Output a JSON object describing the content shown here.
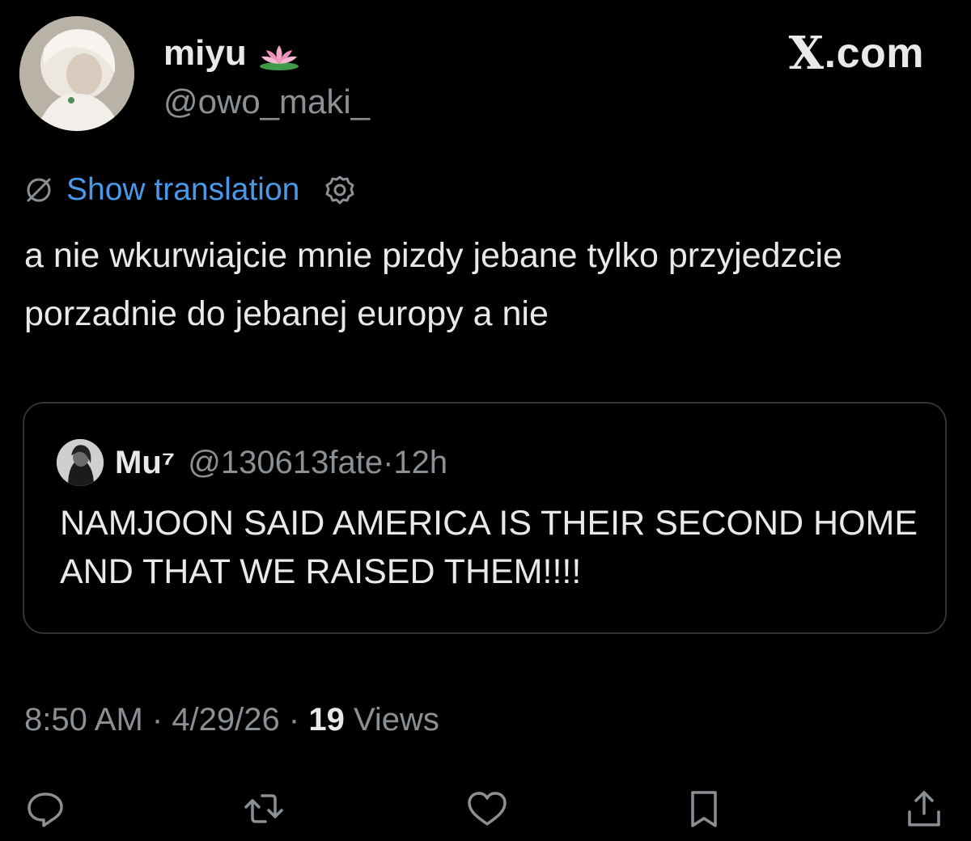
{
  "author": {
    "display_name": "miyu",
    "handle": "@owo_maki_",
    "badge_icon": "lotus-icon"
  },
  "brand": {
    "label": ".com",
    "logo": "X"
  },
  "translation": {
    "label": "Show translation"
  },
  "tweet": {
    "text": "a nie wkurwiajcie mnie pizdy jebane tylko przyjedzcie porzadnie do jebanej europy a nie"
  },
  "quote": {
    "name": "Mu⁷",
    "handle_time": "@130613fate·12h",
    "text": "NAMJOON SAID AMERICA IS THEIR SECOND HOME AND THAT WE RAISED THEM!!!!"
  },
  "meta": {
    "time": "8:50 AM",
    "sep1": " · ",
    "date": "4/29/26",
    "sep2": " · ",
    "views_count": "19",
    "views_label": " Views"
  },
  "actions": {
    "reply": "reply-icon",
    "retweet": "retweet-icon",
    "like": "heart-icon",
    "bookmark": "bookmark-icon",
    "share": "share-icon"
  },
  "colors": {
    "background": "#000000",
    "text_primary": "#e7e9ea",
    "text_secondary": "#8b9095",
    "link": "#4a99e9",
    "border": "#2f3336"
  }
}
